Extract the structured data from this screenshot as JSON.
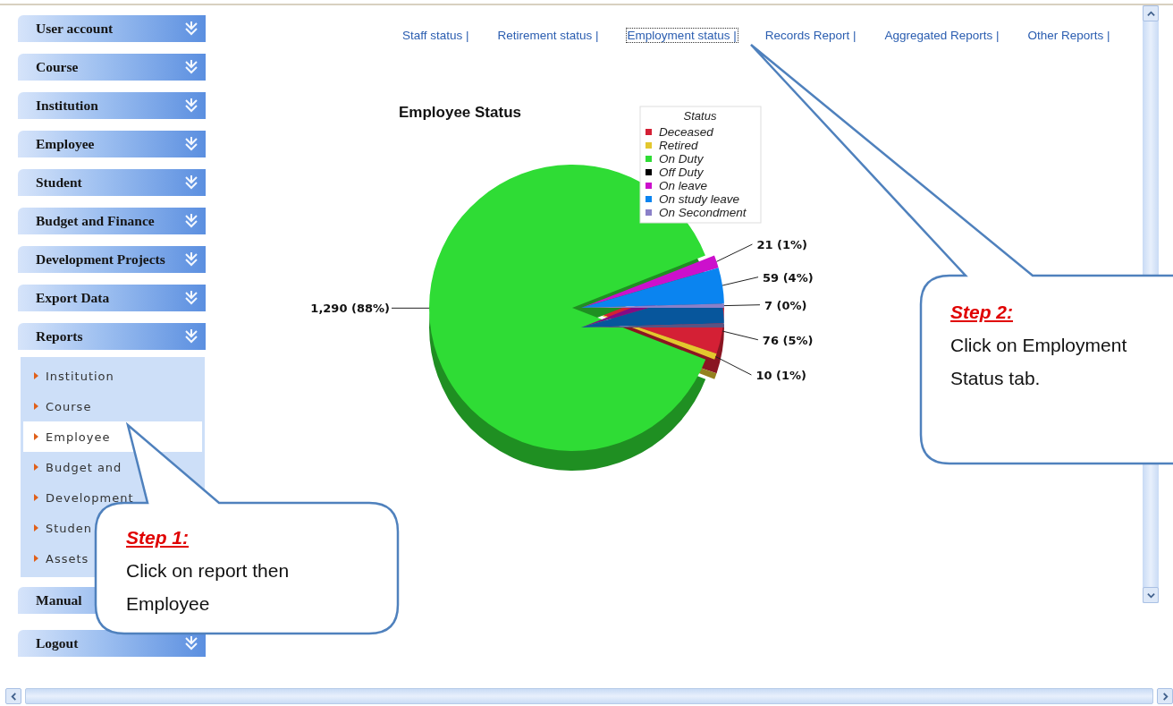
{
  "sidebar": {
    "items": [
      {
        "label": "User account",
        "expanded": false,
        "chevron": true
      },
      {
        "label": "Course",
        "expanded": false,
        "chevron": true
      },
      {
        "label": "Institution",
        "expanded": false,
        "chevron": true
      },
      {
        "label": "Employee",
        "expanded": false,
        "chevron": true
      },
      {
        "label": "Student",
        "expanded": false,
        "chevron": true
      },
      {
        "label": "Budget and Finance",
        "expanded": false,
        "chevron": true
      },
      {
        "label": "Development Projects",
        "expanded": false,
        "chevron": true
      },
      {
        "label": "Export Data",
        "expanded": false,
        "chevron": true
      },
      {
        "label": "Reports",
        "expanded": true,
        "chevron": true,
        "children": [
          {
            "label": "Institution",
            "selected": false
          },
          {
            "label": "Course",
            "selected": false
          },
          {
            "label": "Employee",
            "selected": true
          },
          {
            "label": "Budget and",
            "selected": false
          },
          {
            "label": "Development",
            "selected": false
          },
          {
            "label": "Studen",
            "selected": false
          },
          {
            "label": "Assets",
            "selected": false
          }
        ]
      },
      {
        "label": "Manual",
        "expanded": false,
        "chevron": false
      },
      {
        "label": "Logout",
        "expanded": false,
        "chevron": true
      }
    ]
  },
  "report_links": [
    {
      "label": "Staff status |",
      "selected": false
    },
    {
      "label": "Retirement status |",
      "selected": false
    },
    {
      "label": "Employment status |",
      "selected": true
    },
    {
      "label": "Records Report |",
      "selected": false
    },
    {
      "label": "Aggregated Reports |",
      "selected": false
    },
    {
      "label": "Other Reports |",
      "selected": false
    }
  ],
  "chart": {
    "chart_data": {
      "type": "pie",
      "title": "Employee Status",
      "categories": [
        "Deceased",
        "Retired",
        "On Duty",
        "Off Duty",
        "On leave",
        "On study leave",
        "On Secondment"
      ],
      "values": [
        76,
        10,
        1290,
        0,
        21,
        59,
        7
      ],
      "colors": [
        "#d42035",
        "#e3c72e",
        "#2fdc35",
        "#000000",
        "#cc10cc",
        "#0a84f0",
        "#8a80c8"
      ],
      "legend": {
        "title": "Status"
      },
      "value_labels": [
        "76 (5%)",
        "10 (1%)",
        "1,290 (88%)",
        null,
        "21 (1%)",
        "59 (4%)",
        "7 (0%)"
      ]
    }
  },
  "callouts": [
    {
      "title": "Step 1:",
      "text": "Click on report then Employee"
    },
    {
      "title": "Step 2:",
      "text": "Click on Employment Status tab."
    }
  ]
}
